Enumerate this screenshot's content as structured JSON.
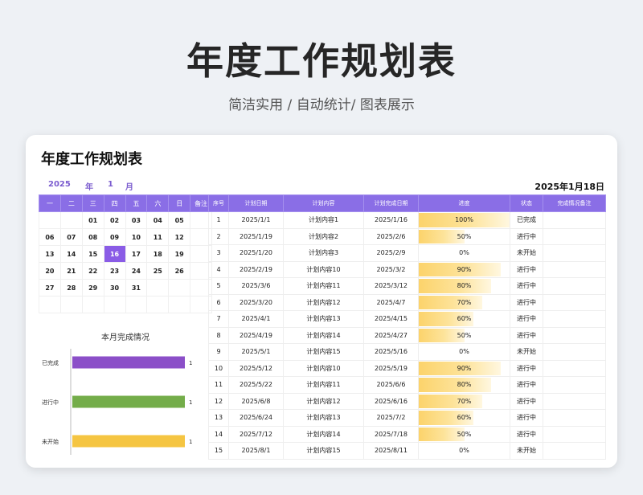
{
  "hero": {
    "title": "年度工作规划表",
    "subtitle": "简洁实用 / 自动统计/ 图表展示"
  },
  "card": {
    "title": "年度工作规划表",
    "year": "2025",
    "year_label": "年",
    "month": "1",
    "month_label": "月",
    "date_display": "2025年1月18日"
  },
  "calendar": {
    "headers": [
      "一",
      "二",
      "三",
      "四",
      "五",
      "六",
      "日",
      "备注"
    ],
    "today": "16",
    "weeks": [
      [
        "",
        "",
        "01",
        "02",
        "03",
        "04",
        "05",
        ""
      ],
      [
        "06",
        "07",
        "08",
        "09",
        "10",
        "11",
        "12",
        ""
      ],
      [
        "13",
        "14",
        "15",
        "16",
        "17",
        "18",
        "19",
        ""
      ],
      [
        "20",
        "21",
        "22",
        "23",
        "24",
        "25",
        "26",
        ""
      ],
      [
        "27",
        "28",
        "29",
        "30",
        "31",
        "",
        "",
        ""
      ],
      [
        "",
        "",
        "",
        "",
        "",
        "",
        "",
        ""
      ]
    ]
  },
  "chart_data": {
    "type": "bar",
    "orientation": "horizontal",
    "title": "本月完成情况",
    "categories": [
      "已完成",
      "进行中",
      "未开始"
    ],
    "values": [
      1,
      1,
      1
    ],
    "colors": [
      "#8b4fc8",
      "#74ad4a",
      "#f5c542"
    ]
  },
  "plan": {
    "headers": [
      "序号",
      "计划日期",
      "计划内容",
      "计划完成日期",
      "进度",
      "状态",
      "完成情况备注"
    ],
    "rows": [
      {
        "no": "1",
        "date": "2025/1/1",
        "content": "计划内容1",
        "due": "2025/1/16",
        "progress": "100%",
        "status": "已完成",
        "note": ""
      },
      {
        "no": "2",
        "date": "2025/1/19",
        "content": "计划内容2",
        "due": "2025/2/6",
        "progress": "50%",
        "status": "进行中",
        "note": ""
      },
      {
        "no": "3",
        "date": "2025/1/20",
        "content": "计划内容3",
        "due": "2025/2/9",
        "progress": "0%",
        "status": "未开始",
        "note": ""
      },
      {
        "no": "4",
        "date": "2025/2/19",
        "content": "计划内容10",
        "due": "2025/3/2",
        "progress": "90%",
        "status": "进行中",
        "note": ""
      },
      {
        "no": "5",
        "date": "2025/3/6",
        "content": "计划内容11",
        "due": "2025/3/12",
        "progress": "80%",
        "status": "进行中",
        "note": ""
      },
      {
        "no": "6",
        "date": "2025/3/20",
        "content": "计划内容12",
        "due": "2025/4/7",
        "progress": "70%",
        "status": "进行中",
        "note": ""
      },
      {
        "no": "7",
        "date": "2025/4/1",
        "content": "计划内容13",
        "due": "2025/4/15",
        "progress": "60%",
        "status": "进行中",
        "note": ""
      },
      {
        "no": "8",
        "date": "2025/4/19",
        "content": "计划内容14",
        "due": "2025/4/27",
        "progress": "50%",
        "status": "进行中",
        "note": ""
      },
      {
        "no": "9",
        "date": "2025/5/1",
        "content": "计划内容15",
        "due": "2025/5/16",
        "progress": "0%",
        "status": "未开始",
        "note": ""
      },
      {
        "no": "10",
        "date": "2025/5/12",
        "content": "计划内容10",
        "due": "2025/5/19",
        "progress": "90%",
        "status": "进行中",
        "note": ""
      },
      {
        "no": "11",
        "date": "2025/5/22",
        "content": "计划内容11",
        "due": "2025/6/6",
        "progress": "80%",
        "status": "进行中",
        "note": ""
      },
      {
        "no": "12",
        "date": "2025/6/8",
        "content": "计划内容12",
        "due": "2025/6/16",
        "progress": "70%",
        "status": "进行中",
        "note": ""
      },
      {
        "no": "13",
        "date": "2025/6/24",
        "content": "计划内容13",
        "due": "2025/7/2",
        "progress": "60%",
        "status": "进行中",
        "note": ""
      },
      {
        "no": "14",
        "date": "2025/7/12",
        "content": "计划内容14",
        "due": "2025/7/18",
        "progress": "50%",
        "status": "进行中",
        "note": ""
      },
      {
        "no": "15",
        "date": "2025/8/1",
        "content": "计划内容15",
        "due": "2025/8/11",
        "progress": "0%",
        "status": "未开始",
        "note": ""
      }
    ]
  }
}
